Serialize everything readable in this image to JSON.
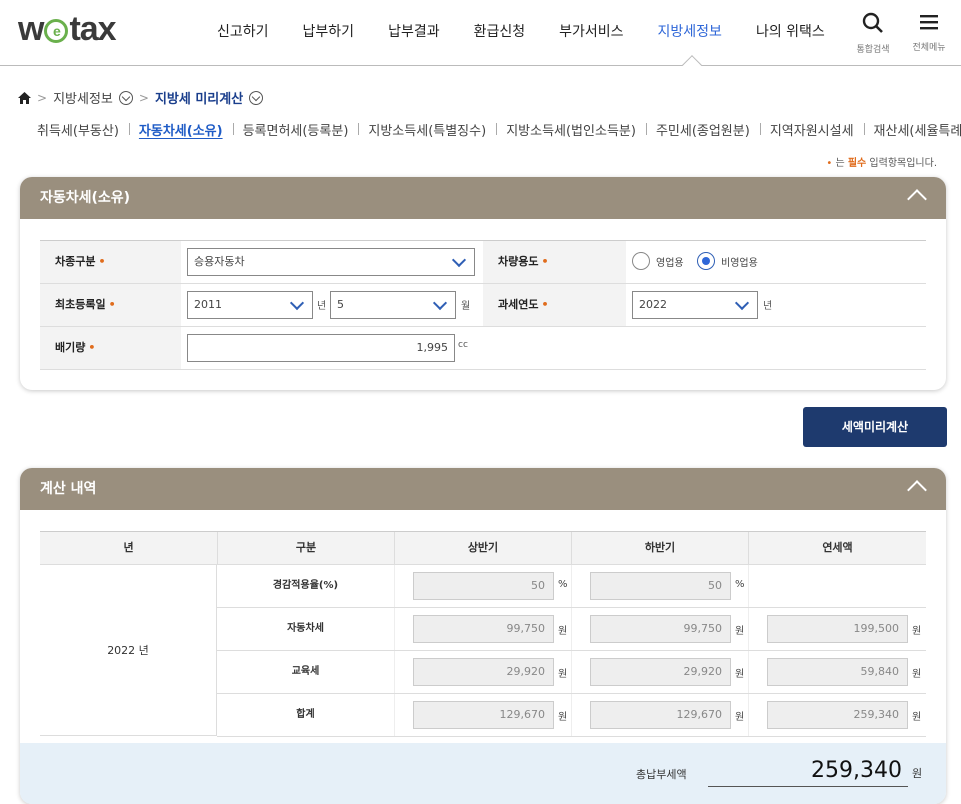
{
  "header": {
    "logo_text_1": "w",
    "logo_text_e": "e",
    "logo_text_2": "tax",
    "nav": [
      "신고하기",
      "납부하기",
      "납부결과",
      "환급신청",
      "부가서비스",
      "지방세정보",
      "나의 위택스"
    ],
    "active_nav": "지방세정보",
    "search_label": "통합검색",
    "menu_label": "전체메뉴",
    "search_icon": "search-icon",
    "menu_icon": "hamburger-icon"
  },
  "breadcrumb": {
    "home_icon": "home-icon",
    "level1": "지방세정보",
    "level2": "지방세 미리계산"
  },
  "subtabs": [
    "취득세(부동산)",
    "자동차세(소유)",
    "등록면허세(등록분)",
    "지방소득세(특별징수)",
    "지방소득세(법인소득분)",
    "주민세(종업원분)",
    "지역자원시설세",
    "재산세(세율특례)"
  ],
  "active_subtab": "자동차세(소유)",
  "required_note": {
    "dot": "•",
    "pre": " 는 ",
    "must": "필수",
    "post": " 입력항목입니다."
  },
  "form_panel": {
    "title": "자동차세(소유)",
    "star": "•",
    "vehicle_type_label": "차종구분",
    "vehicle_type_value": "승용자동차",
    "usage_label": "차량용도",
    "usage_options": [
      "영업용",
      "비영업용"
    ],
    "usage_selected": "비영업용",
    "first_reg_label": "최초등록일",
    "first_reg_year": "2011",
    "year_unit": "년",
    "first_reg_month": "5",
    "month_unit": "월",
    "tax_year_label": "과세연도",
    "tax_year_value": "2022",
    "tax_year_unit": "년",
    "displacement_label": "배기량",
    "displacement_value": "1,995",
    "displacement_unit": "cc"
  },
  "calc_button": "세액미리계산",
  "result_panel": {
    "title": "계산 내역",
    "headers": [
      "년",
      "구분",
      "상반기",
      "하반기",
      "연세액"
    ],
    "year": "2022 년",
    "rows": [
      {
        "label": "경감적용율(%)",
        "h1": "50",
        "h2": "50",
        "annual": "",
        "unit": "%"
      },
      {
        "label": "자동차세",
        "h1": "99,750",
        "h2": "99,750",
        "annual": "199,500",
        "unit": "원"
      },
      {
        "label": "교육세",
        "h1": "29,920",
        "h2": "29,920",
        "annual": "59,840",
        "unit": "원"
      },
      {
        "label": "합계",
        "h1": "129,670",
        "h2": "129,670",
        "annual": "259,340",
        "unit": "원"
      }
    ],
    "total_label": "총납부세액",
    "total_value": "259,340",
    "total_unit": "원"
  },
  "colors": {
    "panel_header": "#9a8f7e",
    "accent_blue": "#2f67d8",
    "button": "#1e3a6e",
    "required": "#e06c1c"
  }
}
